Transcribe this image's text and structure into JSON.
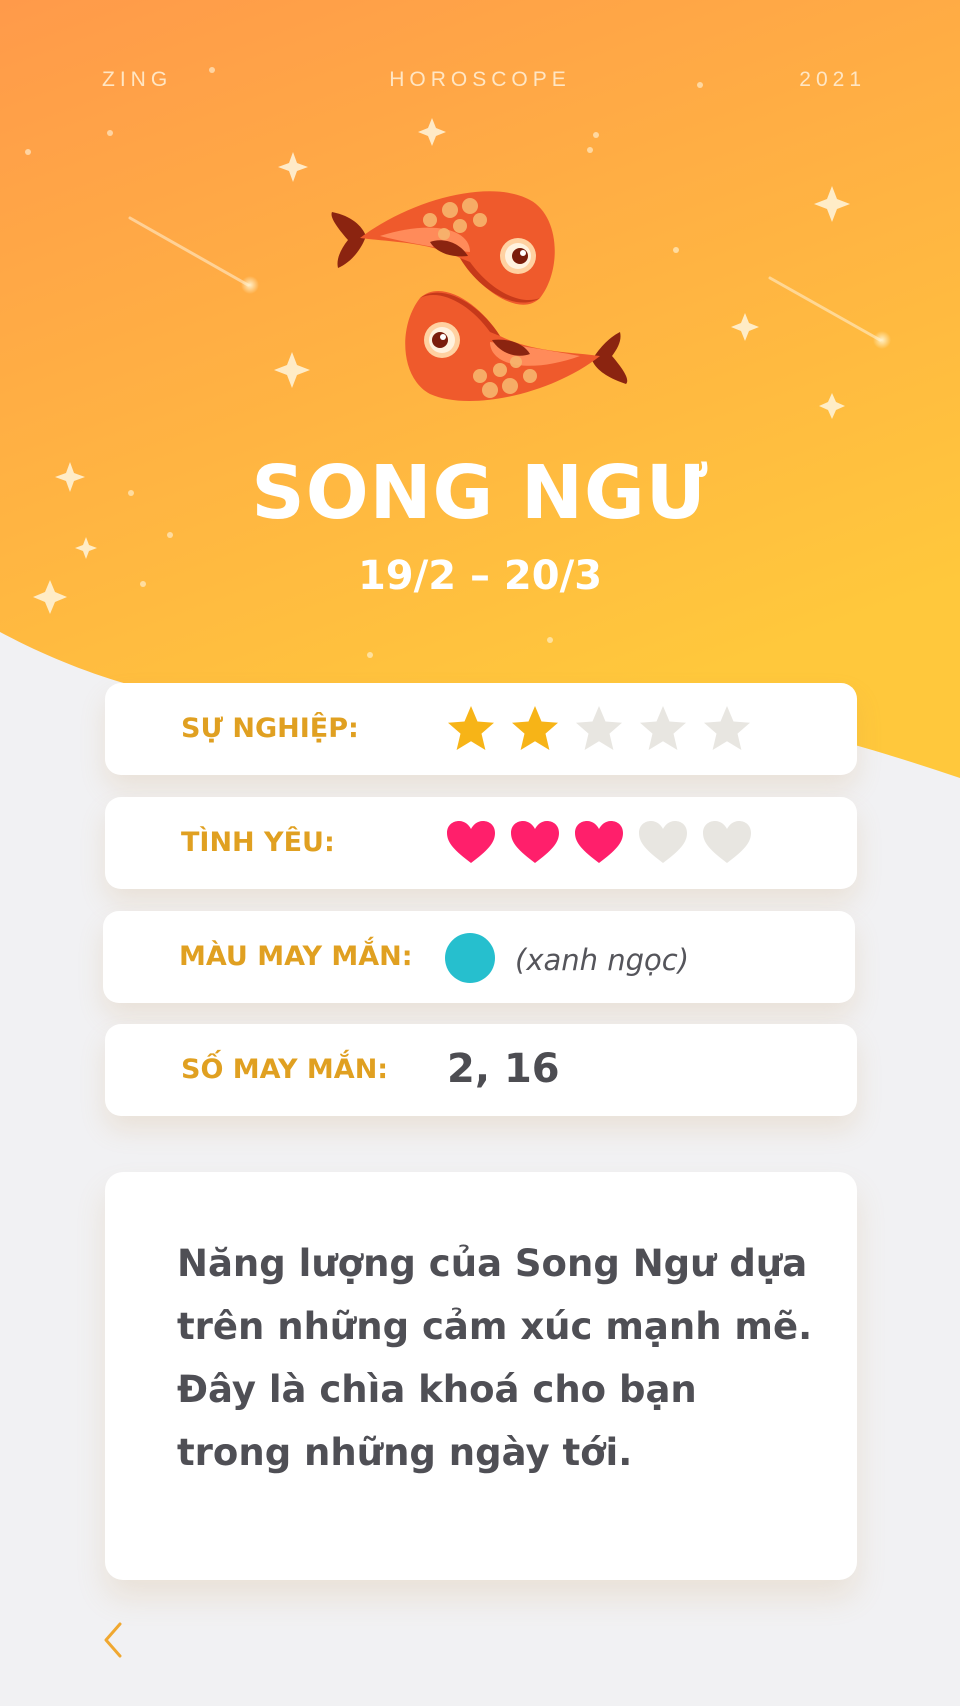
{
  "header": {
    "left": "ZING",
    "center": "HOROSCOPE",
    "right": "2021"
  },
  "sign": {
    "name": "SONG NGƯ",
    "dates": "19/2 – 20/3",
    "emblem_icon": "pisces-fish-icon"
  },
  "stats": {
    "career": {
      "label": "SỰ NGHIỆP:",
      "rating": 2,
      "max": 5,
      "icon": "star-icon"
    },
    "love": {
      "label": "TÌNH YÊU:",
      "rating": 3,
      "max": 5,
      "icon": "heart-icon"
    },
    "lucky_color": {
      "label": "MÀU MAY MẮN:",
      "color_hex": "#26bfce",
      "name": "(xanh ngọc)"
    },
    "lucky_number": {
      "label": "SỐ MAY MẮN:",
      "value": "2, 16"
    }
  },
  "description": "Năng lượng của Song Ngư dựa trên những cảm xúc mạnh mẽ. Đây là chìa khoá cho bạn trong những ngày tới.",
  "nav": {
    "back_icon": "chevron-left-icon"
  },
  "colors": {
    "gradient_top": "#ff9a4a",
    "gradient_bottom": "#ffc83c",
    "label_gold": "#e0a021",
    "star_active": "#f7b417",
    "heart_active": "#ff1f6b",
    "inactive": "#e8e6e1"
  }
}
